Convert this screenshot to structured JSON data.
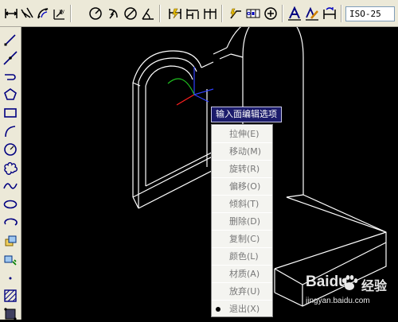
{
  "toolbar": {
    "dim_style": "ISO-25",
    "icons": [
      "linear-dimension-icon",
      "aligned-dimension-icon",
      "arc-length-icon",
      "ordinate-icon",
      "radius-icon",
      "jogged-icon",
      "diameter-icon",
      "angular-icon",
      "quick-dimension-icon",
      "baseline-icon",
      "continue-icon",
      "quick-leader-icon",
      "tolerance-icon",
      "center-mark-icon",
      "dimension-edit-icon",
      "dimension-text-edit-icon",
      "dimension-update-icon"
    ]
  },
  "left_toolbar": {
    "icons": [
      "line-icon",
      "construction-line-icon",
      "polyline-icon",
      "polygon-icon",
      "rectangle-icon",
      "arc-icon",
      "circle-icon",
      "revision-cloud-icon",
      "spline-icon",
      "ellipse-icon",
      "ellipse-arc-icon",
      "insert-block-icon",
      "make-block-icon",
      "point-icon",
      "hatch-icon",
      "region-icon"
    ]
  },
  "prompt": {
    "text": "输入面编辑选项"
  },
  "context_menu": {
    "items": [
      {
        "label": "拉伸(E)",
        "enabled": false,
        "bullet": false
      },
      {
        "label": "移动(M)",
        "enabled": false,
        "bullet": false
      },
      {
        "label": "旋转(R)",
        "enabled": false,
        "bullet": false
      },
      {
        "label": "偏移(O)",
        "enabled": false,
        "bullet": false
      },
      {
        "label": "倾斜(T)",
        "enabled": false,
        "bullet": false
      },
      {
        "label": "删除(D)",
        "enabled": false,
        "bullet": false
      },
      {
        "label": "复制(C)",
        "enabled": false,
        "bullet": false
      },
      {
        "label": "颜色(L)",
        "enabled": false,
        "bullet": false
      },
      {
        "label": "材质(A)",
        "enabled": false,
        "bullet": false
      },
      {
        "label": "放弃(U)",
        "enabled": false,
        "bullet": false
      },
      {
        "label": "退出(X)",
        "enabled": false,
        "bullet": true
      }
    ]
  },
  "watermark": {
    "brand": "Baidu",
    "word": "经验",
    "url": "jingyan.baidu.com"
  },
  "colors": {
    "canvas": "#000000",
    "model_lines": "#ffffff",
    "ucs_x": "#ff2020",
    "ucs_y": "#20c020",
    "ucs_z": "#3040ff",
    "prompt_bg": "#1b1b6b"
  }
}
